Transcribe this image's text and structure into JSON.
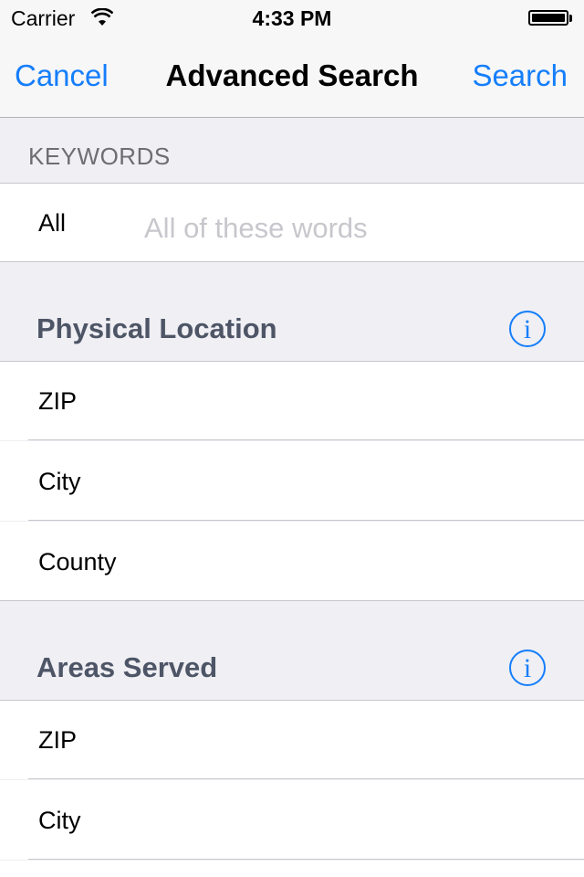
{
  "status_bar": {
    "carrier": "Carrier",
    "time": "4:33 PM",
    "wifi_icon": "wifi-icon",
    "battery_icon": "battery-icon"
  },
  "nav": {
    "cancel_label": "Cancel",
    "title": "Advanced Search",
    "search_label": "Search",
    "accent_color": "#157efb"
  },
  "keywords": {
    "header": "KEYWORDS",
    "all_label": "All",
    "all_placeholder": "All of these words",
    "all_value": ""
  },
  "physical_location": {
    "title": "Physical Location",
    "info_glyph": "i",
    "rows": [
      {
        "label": "ZIP"
      },
      {
        "label": "City"
      },
      {
        "label": "County"
      }
    ]
  },
  "areas_served": {
    "title": "Areas Served",
    "info_glyph": "i",
    "rows": [
      {
        "label": "ZIP"
      },
      {
        "label": "City"
      }
    ]
  }
}
